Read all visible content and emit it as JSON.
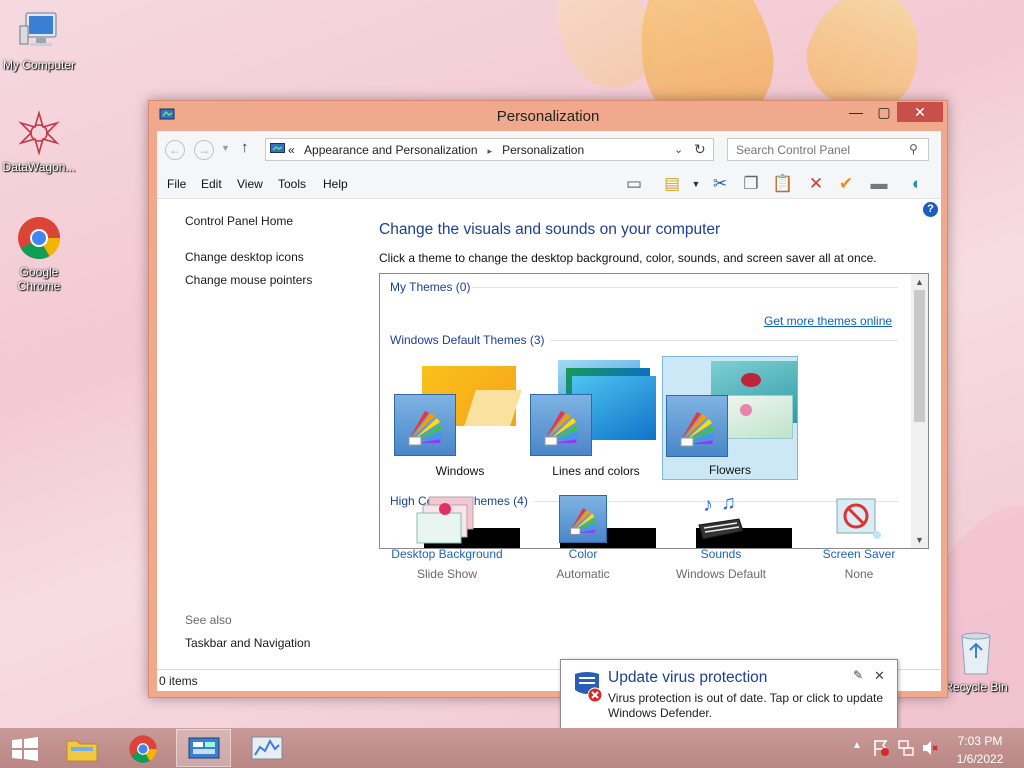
{
  "desktop": {
    "icons": [
      {
        "label": "My Computer"
      },
      {
        "label": "DataWagon..."
      },
      {
        "label": "Google Chrome"
      },
      {
        "label": "Recycle Bin"
      }
    ]
  },
  "window": {
    "title": "Personalization",
    "address": {
      "prefix": "«",
      "crumb1": "Appearance and Personalization",
      "sep": "▸",
      "crumb2": "Personalization"
    },
    "search_placeholder": "Search Control Panel",
    "menu": [
      "File",
      "Edit",
      "View",
      "Tools",
      "Help"
    ],
    "left": {
      "home": "Control Panel Home",
      "links": [
        "Change desktop icons",
        "Change mouse pointers"
      ],
      "see_also": "See also",
      "see_also_links": [
        "Taskbar and Navigation"
      ]
    },
    "main": {
      "heading": "Change the visuals and sounds on your computer",
      "subtext": "Click a theme to change the desktop background, color, sounds, and screen saver all at once.",
      "groups": {
        "my_themes": "My Themes (0)",
        "get_more": "Get more themes online",
        "default_themes": "Windows Default Themes (3)",
        "high_contrast": "High Contrast Themes (4)"
      },
      "themes": [
        {
          "label": "Windows",
          "selected": false
        },
        {
          "label": "Lines and colors",
          "selected": false
        },
        {
          "label": "Flowers",
          "selected": true
        }
      ],
      "bottom": [
        {
          "link": "Desktop Background",
          "sub": "Slide Show"
        },
        {
          "link": "Color",
          "sub": "Automatic"
        },
        {
          "link": "Sounds",
          "sub": "Windows Default"
        },
        {
          "link": "Screen Saver",
          "sub": "None"
        }
      ]
    },
    "status": "0 items"
  },
  "balloon": {
    "title": "Update virus protection",
    "message": "Virus protection is out of date. Tap or click to update Windows Defender."
  },
  "taskbar": {
    "time": "7:03 PM",
    "date": "1/6/2022"
  },
  "colors": {
    "accent": "#f0a98c",
    "link": "#1c64b8",
    "heading": "#1c3f95",
    "close": "#c7504a"
  }
}
